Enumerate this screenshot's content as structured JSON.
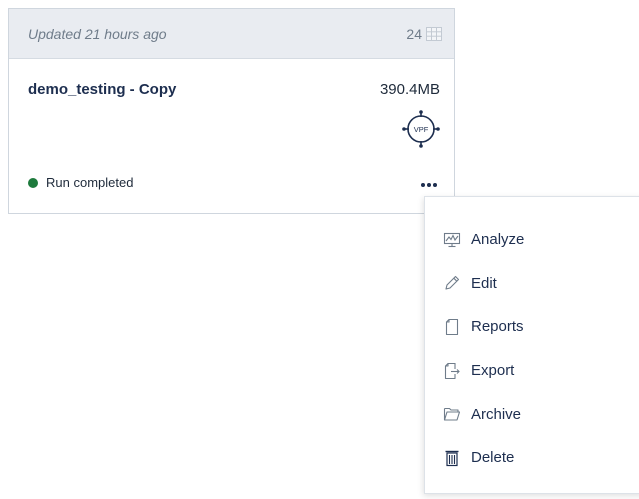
{
  "card": {
    "updated_text": "Updated 21 hours ago",
    "count": "24",
    "count_icon": "grid-icon",
    "name": "demo_testing - Copy",
    "size": "390.4MB",
    "badge_label": "VPF",
    "badge_icon": "vpf-target-icon",
    "status": {
      "label": "Run completed",
      "color": "#1d7a3c"
    },
    "more_icon": "more-horizontal-icon"
  },
  "menu": {
    "items": [
      {
        "label": "Analyze",
        "icon": "analyze-icon"
      },
      {
        "label": "Edit",
        "icon": "pencil-icon"
      },
      {
        "label": "Reports",
        "icon": "document-icon"
      },
      {
        "label": "Export",
        "icon": "export-icon"
      },
      {
        "label": "Archive",
        "icon": "folder-icon"
      },
      {
        "label": "Delete",
        "icon": "trash-icon"
      }
    ]
  },
  "colors": {
    "header_bg": "#e9ecf1",
    "primary_text": "#1d2e4f",
    "muted_text": "#6f7c8a"
  }
}
